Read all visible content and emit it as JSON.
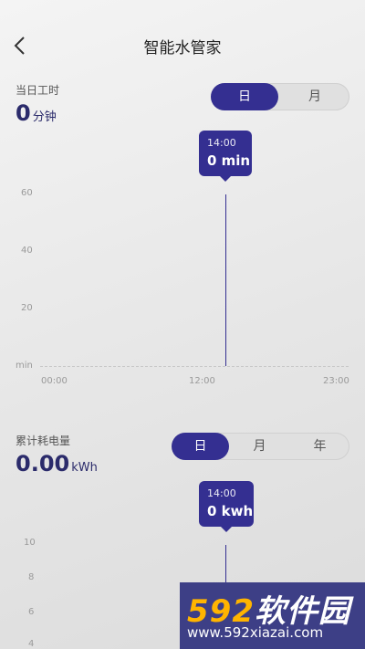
{
  "header": {
    "title": "智能水管家",
    "back_icon": "chevron-left-icon"
  },
  "work_time": {
    "label": "当日工时",
    "value": "0",
    "unit": "分钟",
    "tabs": [
      "日",
      "月"
    ],
    "active_tab": "日",
    "tooltip": {
      "time": "14:00",
      "value": "0 min"
    },
    "chart_data": {
      "type": "line",
      "x": [
        "00:00",
        "12:00",
        "23:00"
      ],
      "y_ticks": [
        "60",
        "40",
        "20"
      ],
      "y_unit": "min",
      "highlight": {
        "x": "14:00",
        "y": 0
      },
      "ylim": [
        0,
        60
      ]
    }
  },
  "energy": {
    "label": "累计耗电量",
    "value": "0.00",
    "unit": "kWh",
    "tabs": [
      "日",
      "月",
      "年"
    ],
    "active_tab": "日",
    "tooltip": {
      "time": "14:00",
      "value": "0 kwh"
    },
    "chart_data": {
      "type": "line",
      "y_ticks": [
        "10",
        "8",
        "6",
        "4"
      ],
      "highlight": {
        "x": "14:00",
        "y": 0
      }
    }
  },
  "watermark": {
    "big_num": "592",
    "big_text": "软件园",
    "url": "www.592xiazai.com"
  },
  "colors": {
    "accent": "#342f91",
    "watermark_bg": "#3d3f86",
    "watermark_num": "#ffb400"
  }
}
